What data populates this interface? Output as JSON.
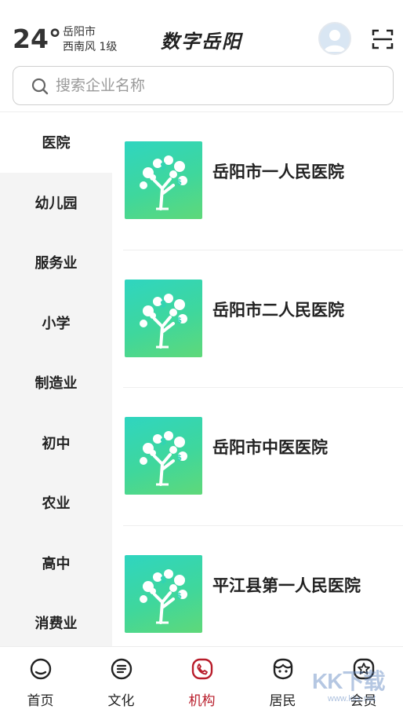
{
  "header": {
    "temperature": "24°",
    "city": "岳阳市",
    "wind": "西南风  1级",
    "brand": "数字岳阳",
    "avatar_icon": "user-avatar-icon",
    "scan_icon": "scan-icon"
  },
  "search": {
    "placeholder": "搜索企业名称",
    "icon": "search-icon"
  },
  "sidebar": {
    "active_index": 0,
    "items": [
      {
        "label": "医院"
      },
      {
        "label": "幼儿园"
      },
      {
        "label": "服务业"
      },
      {
        "label": "小学"
      },
      {
        "label": "制造业"
      },
      {
        "label": "初中"
      },
      {
        "label": "农业"
      },
      {
        "label": "高中"
      },
      {
        "label": "消费业"
      }
    ]
  },
  "list": {
    "items": [
      {
        "name": "岳阳市一人民医院"
      },
      {
        "name": "岳阳市二人民医院"
      },
      {
        "name": "岳阳市中医医院"
      },
      {
        "name": "平江县第一人民医院"
      }
    ]
  },
  "tabbar": {
    "active_index": 2,
    "accent": "#b81c2a",
    "items": [
      {
        "label": "首页",
        "icon": "home-icon"
      },
      {
        "label": "文化",
        "icon": "culture-icon"
      },
      {
        "label": "机构",
        "icon": "phone-icon"
      },
      {
        "label": "居民",
        "icon": "resident-icon"
      },
      {
        "label": "会员",
        "icon": "member-icon"
      }
    ]
  },
  "watermark": {
    "text": "KK下载",
    "sub": "www.kkx.net"
  }
}
